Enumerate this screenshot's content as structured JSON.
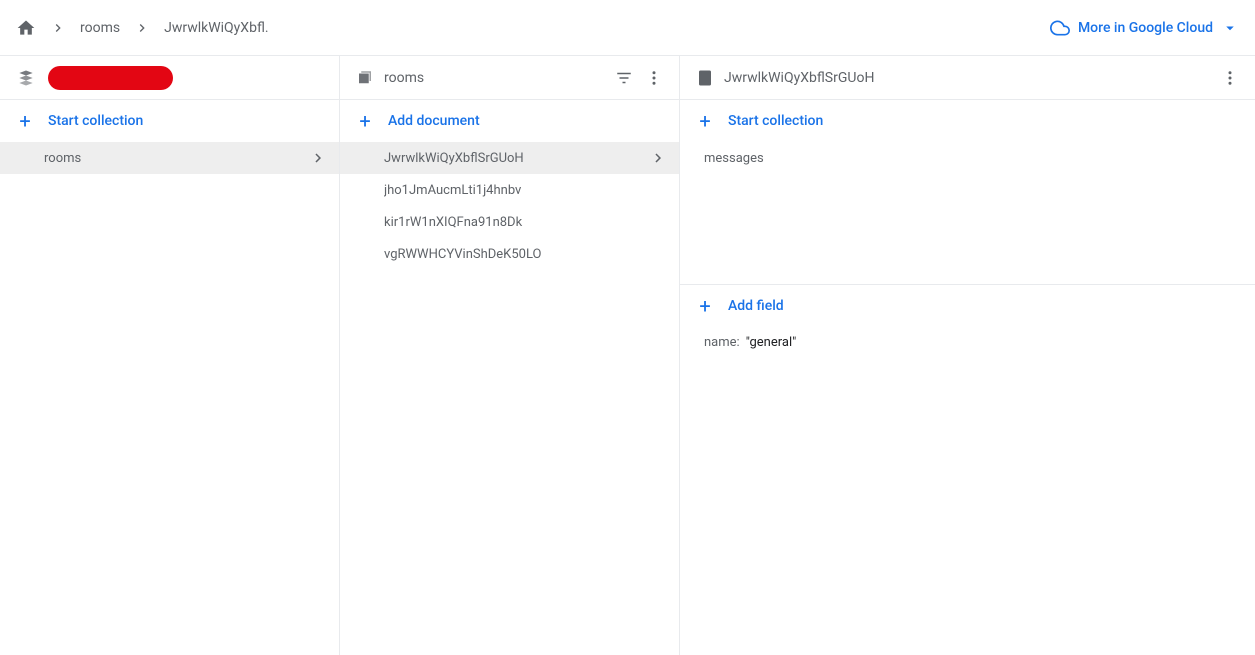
{
  "breadcrumb": {
    "items": [
      "rooms",
      "JwrwlkWiQyXbfl."
    ]
  },
  "cloud_link_label": "More in Google Cloud",
  "col1": {
    "action_label": "Start collection",
    "items": [
      {
        "label": "rooms",
        "selected": true
      }
    ]
  },
  "col2": {
    "title": "rooms",
    "action_label": "Add document",
    "items": [
      {
        "label": "JwrwlkWiQyXbflSrGUoH",
        "selected": true
      },
      {
        "label": "jho1JmAucmLti1j4hnbv",
        "selected": false
      },
      {
        "label": "kir1rW1nXIQFna91n8Dk",
        "selected": false
      },
      {
        "label": "vgRWWHCYVinShDeK50LO",
        "selected": false
      }
    ]
  },
  "col3": {
    "title": "JwrwlkWiQyXbflSrGUoH",
    "start_collection_label": "Start collection",
    "subcollections": [
      "messages"
    ],
    "add_field_label": "Add field",
    "fields": [
      {
        "key": "name",
        "value": "\"general\""
      }
    ]
  }
}
